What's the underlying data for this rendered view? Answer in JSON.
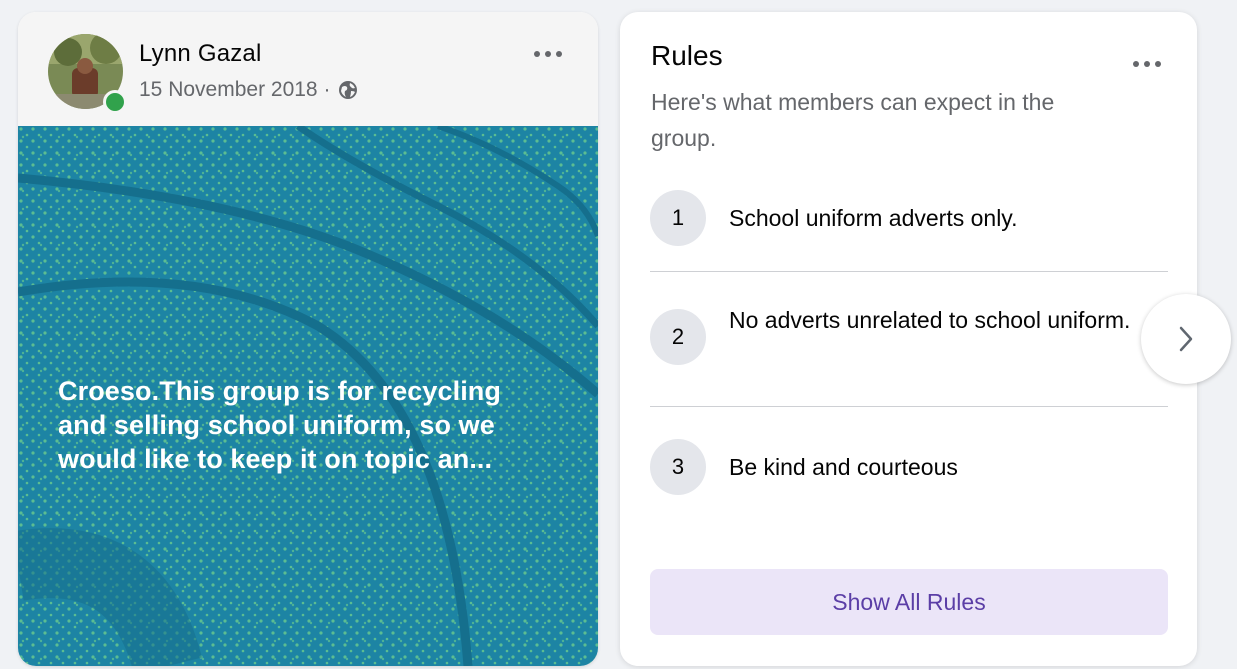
{
  "post": {
    "author": "Lynn Gazal",
    "date": "15 November 2018 ·",
    "privacy_icon": "globe-icon",
    "more_icon": "more-horizontal-icon",
    "text": "Croeso.This group is for recycling\nand selling school uniform, so we\nwould like to keep it on topic an...",
    "background_color": "#1d84a4",
    "dot_color": "#6fd08c",
    "online": true
  },
  "rules": {
    "title": "Rules",
    "subtitle": "Here's what members can expect in the group.",
    "more_icon": "more-horizontal-icon",
    "items": [
      {
        "number": "1",
        "text": "School uniform adverts only."
      },
      {
        "number": "2",
        "text": "No adverts unrelated to school uniform."
      },
      {
        "number": "3",
        "text": "Be kind and courteous"
      }
    ],
    "show_all_label": "Show All Rules",
    "next_icon": "chevron-right-icon",
    "accent_color": "#5b3ea6",
    "button_color": "#ebe5f8"
  }
}
